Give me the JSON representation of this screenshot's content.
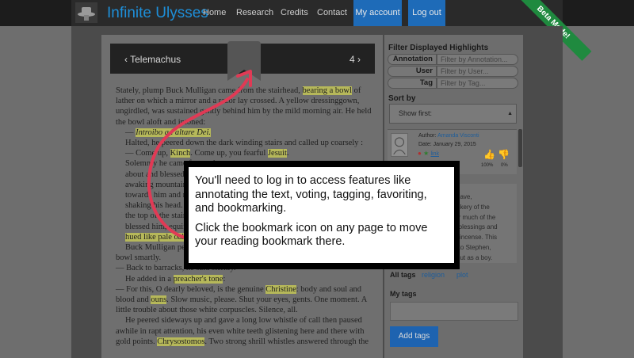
{
  "nav": {
    "brand": "Infinite Ulysses",
    "links": [
      "Home",
      "Research",
      "Credits",
      "Contact"
    ],
    "my_account": "My account",
    "logout": "Log out",
    "ribbon": "Beta Mode!"
  },
  "chapter": {
    "prev": "‹ Telemachus",
    "next": "4 ›"
  },
  "text_lines": [
    [
      "Stately, plump Buck Mulligan came fro",
      "m the stairhead, ",
      "bearing a bowl",
      " of"
    ],
    [
      "lather on which a mirror and a razor lay crossed. A yellow dressinggown,"
    ],
    [
      "ungirdled, was sustained gently behind him by the mild morning air. He held"
    ],
    [
      "the bowl aloft and intoned:"
    ],
    [
      "— ",
      "Introibo ad altare Dei."
    ],
    [
      "Halted, he peered down the dark winding stairs and called up coarsely :"
    ],
    [
      "— Come up, ",
      "Kinch",
      ". Come up, you fearful ",
      "Jesuit",
      "."
    ],
    [
      "Solemnly he came forward"
    ],
    [
      "about and blessed gravely"
    ],
    [
      "awaking mountains. The"
    ],
    [
      "towards him and made"
    ],
    [
      "shaking his head. Stephen"
    ],
    [
      "the top of the staircase"
    ],
    [
      "blessed him, equine in its"
    ],
    [
      "hued like pale oak",
      "."
    ],
    [
      "Buck Mulligan peeped"
    ],
    [
      "bowl smartly."
    ],
    [
      "— Back to barracks, he said sternly."
    ],
    [
      "He added in a ",
      "preacher's tone",
      ":"
    ],
    [
      "— For this, O dearly beloved, is the genuine ",
      "Christine",
      ": body and soul and"
    ],
    [
      "blood and ",
      "ouns",
      ". Slow music, please. Shut your eyes, gents. One moment. A"
    ],
    [
      "little trouble about those white corpuscles. Silence, all."
    ],
    [
      "He peered sideways up and gave a long low whistle of call then paused"
    ],
    [
      "awhile in rapt attention, his even white teeth glistening here and there with"
    ],
    [
      "gold points. ",
      "Chrysostomos",
      ". Two strong shrill whistles answered through the"
    ]
  ],
  "sidebar": {
    "filter_title": "Filter Displayed Highlights",
    "filters": [
      {
        "label": "Annotation",
        "placeholder": "Filter by Annotation..."
      },
      {
        "label": "User",
        "placeholder": "Filter by User..."
      },
      {
        "label": "Tag",
        "placeholder": "Filter by Tag..."
      }
    ],
    "sort_title": "Sort by",
    "sort_value": "Show first:",
    "card": {
      "author_label": "Author: ",
      "author": "Amanda Visconti",
      "date": "Date: January 29, 2015",
      "link": "link",
      "pct_up": "100%",
      "pct_down": "0%"
    },
    "comment_lines": [
      "shave,",
      "ockery of the",
      "for much of the",
      "n blessings and",
      "ly incense. This",
      "n to Stephen,",
      "vout as a boy."
    ],
    "all_tags": "All tags",
    "tag_links": [
      "religion",
      "plot"
    ],
    "my_tags": "My tags",
    "add_tags": "Add tags"
  },
  "modal": {
    "line1": "You'll need to log in to access features like annotating the text, voting, tagging, favoriting, and bookmarking.",
    "line2": "Click the bookmark icon on any page to move your reading bookmark there."
  }
}
